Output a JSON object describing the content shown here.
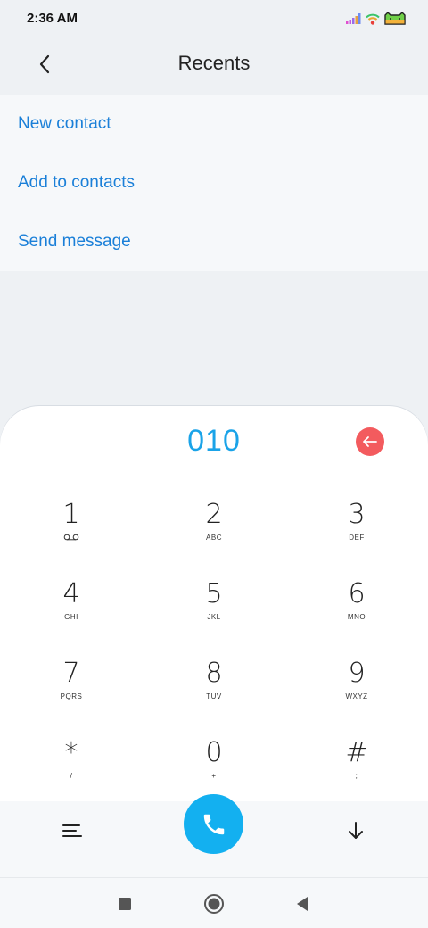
{
  "status_bar": {
    "time": "2:36 AM",
    "icons": [
      "signal-icon",
      "wifi-icon",
      "battery-icon"
    ]
  },
  "header": {
    "title": "Recents",
    "back_icon": "chevron-left-icon"
  },
  "options": [
    {
      "label": "New contact"
    },
    {
      "label": "Add to contacts"
    },
    {
      "label": "Send message"
    }
  ],
  "dialer": {
    "number": "010",
    "backspace_icon": "backspace-icon",
    "keys": [
      {
        "digit": "1",
        "letters": ""
      },
      {
        "digit": "2",
        "letters": "ABC"
      },
      {
        "digit": "3",
        "letters": "DEF"
      },
      {
        "digit": "4",
        "letters": "GHI"
      },
      {
        "digit": "5",
        "letters": "JKL"
      },
      {
        "digit": "6",
        "letters": "MNO"
      },
      {
        "digit": "7",
        "letters": "PQRS"
      },
      {
        "digit": "8",
        "letters": "TUV"
      },
      {
        "digit": "9",
        "letters": "WXYZ"
      },
      {
        "digit": "*",
        "letters": "/"
      },
      {
        "digit": "0",
        "letters": "+"
      },
      {
        "digit": "#",
        "letters": ";"
      }
    ]
  },
  "actions": {
    "menu_icon": "menu-icon",
    "call_icon": "phone-icon",
    "collapse_icon": "arrow-down-icon"
  },
  "nav_bar": {
    "icons": [
      "recents-square-icon",
      "home-circle-icon",
      "back-triangle-icon"
    ]
  },
  "colors": {
    "accent": "#1a7fd8",
    "number": "#1aa3e8",
    "call": "#13b0f0",
    "backspace": "#f35b5e"
  }
}
